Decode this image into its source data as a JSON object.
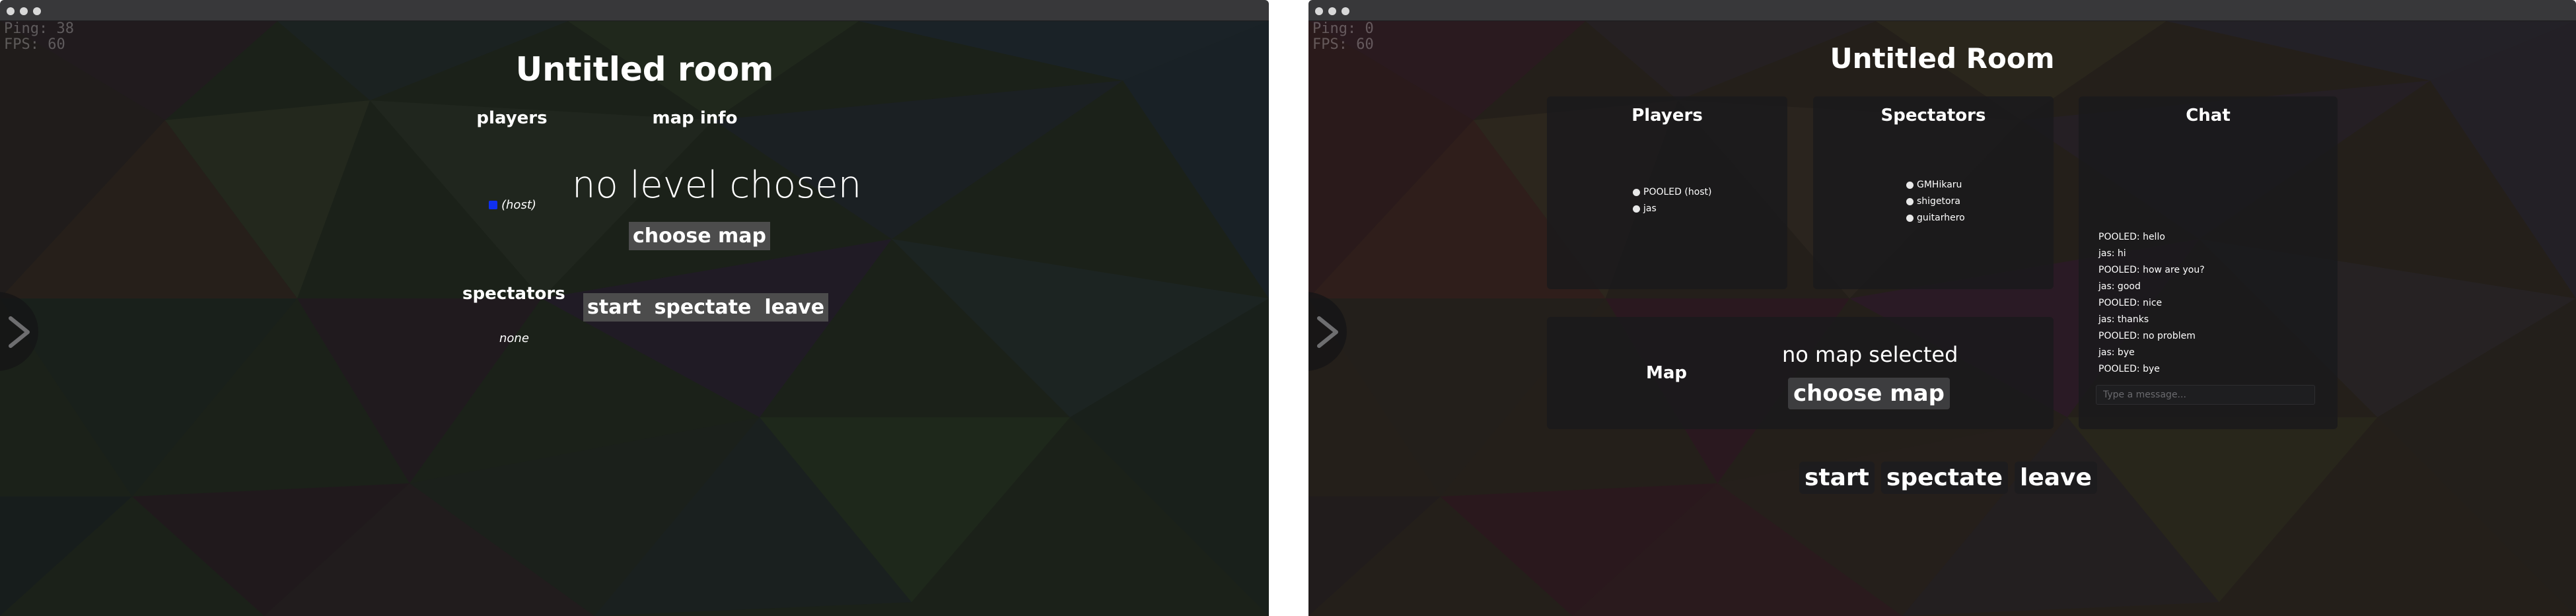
{
  "left": {
    "stats": {
      "ping": "Ping: 38",
      "fps": "FPS: 60"
    },
    "room_title": "Untitled room",
    "players_heading": "players",
    "map_info_heading": "map info",
    "host_label": "(host)",
    "host_color": "#1030ee",
    "no_level_text": "no level chosen",
    "choose_map_label": "choose map",
    "spectators_heading": "spectators",
    "spectators_none": "none",
    "buttons": {
      "start": "start",
      "spectate": "spectate",
      "leave": "leave"
    },
    "nav_arrow_icon": "chevron-right-icon"
  },
  "right": {
    "stats": {
      "ping": "Ping: 0",
      "fps": "FPS: 60"
    },
    "room_title": "Untitled Room",
    "players": {
      "title": "Players",
      "items": [
        "POOLED (host)",
        "jas"
      ]
    },
    "spectators": {
      "title": "Spectators",
      "items": [
        "GMHikaru",
        "shigetora",
        "guitarhero"
      ]
    },
    "chat": {
      "title": "Chat",
      "messages": [
        "POOLED: hello",
        "jas: hi",
        "POOLED: how are you?",
        "jas: good",
        "POOLED: nice",
        "jas: thanks",
        "POOLED: no problem",
        "jas: bye",
        "POOLED: bye"
      ],
      "input_placeholder": "Type a message..."
    },
    "map": {
      "label": "Map",
      "no_map_text": "no map selected",
      "choose_map_label": "choose map"
    },
    "buttons": {
      "start": "start",
      "spectate": "spectate",
      "leave": "leave"
    },
    "nav_arrow_icon": "chevron-right-icon"
  }
}
